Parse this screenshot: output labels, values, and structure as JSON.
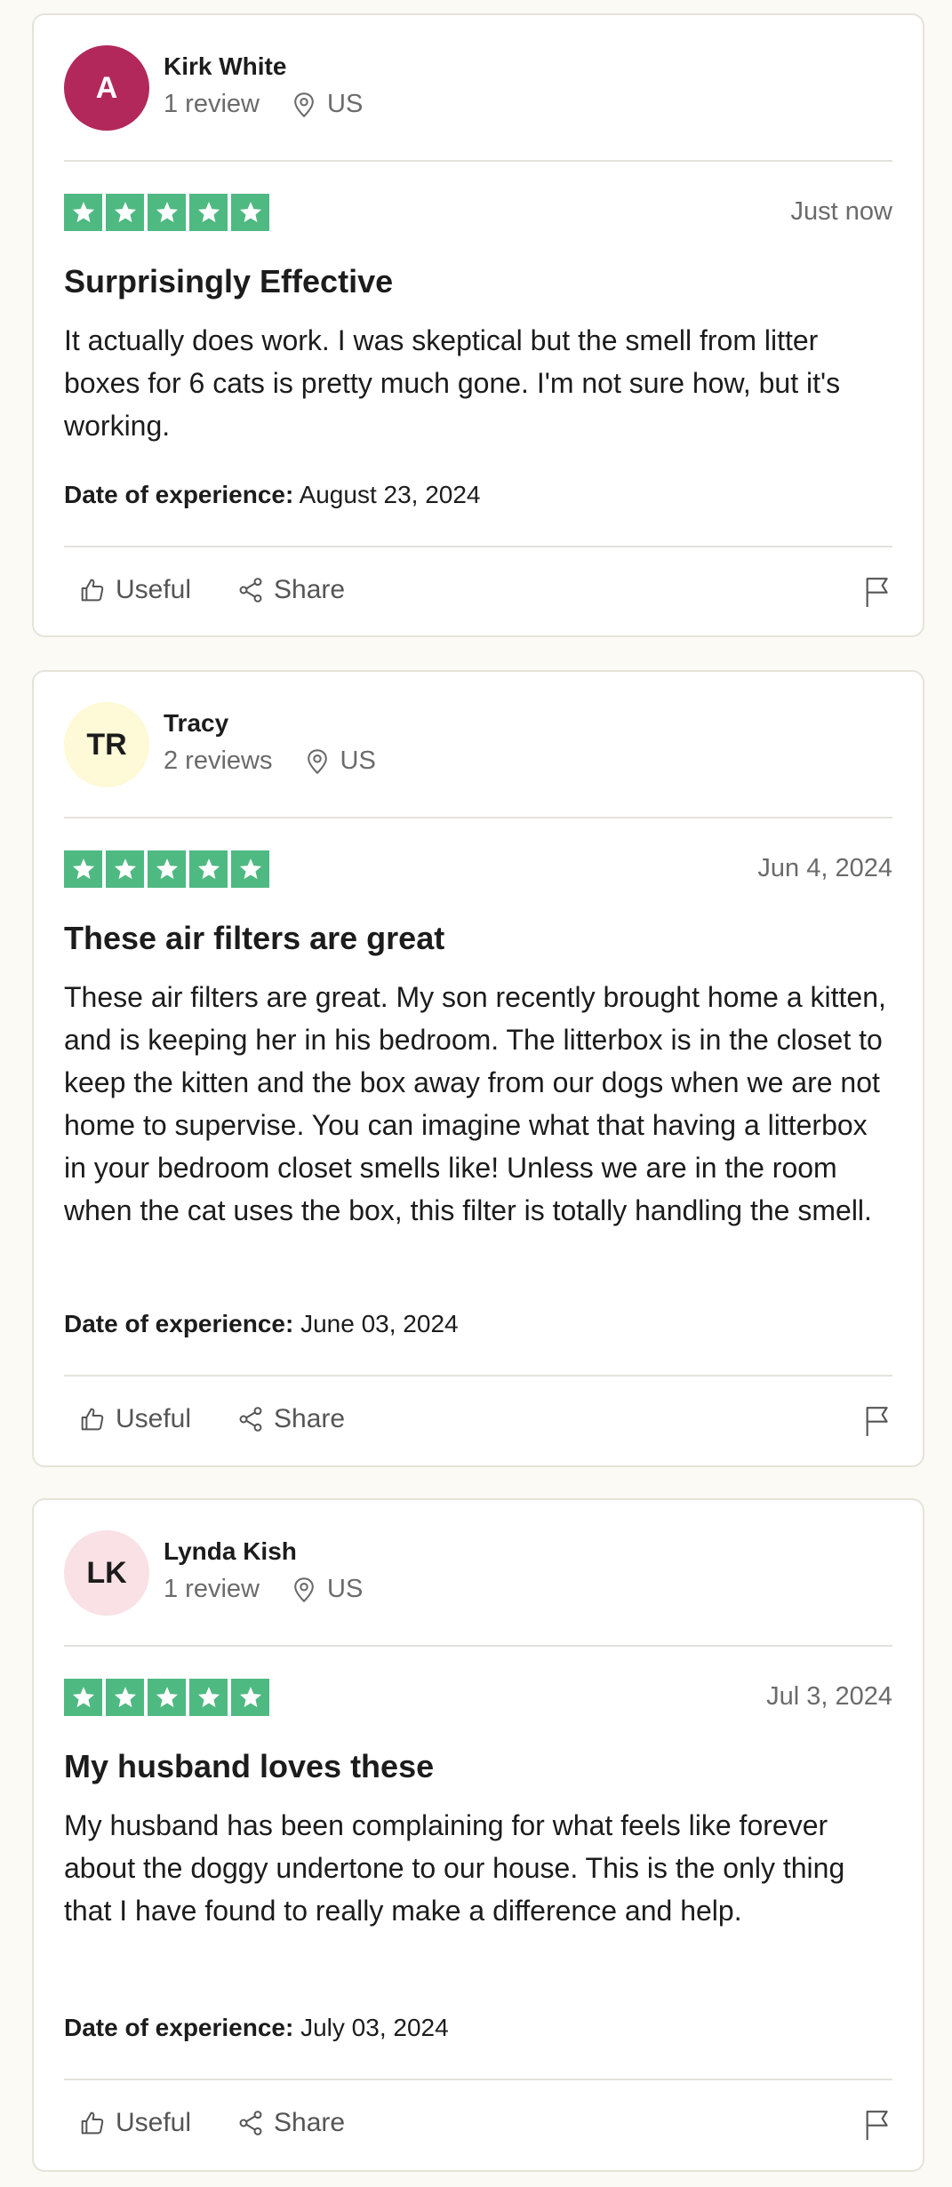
{
  "colors": {
    "page_background": "#fbfaf4",
    "star_green": "#4fb982",
    "text_primary": "#1c1c1c",
    "text_muted": "#6b6b6b"
  },
  "reviews": [
    {
      "avatar": {
        "initials": "A",
        "background": "#b3285b",
        "color": "#ffffff"
      },
      "name": "Kirk White",
      "review_count": "1 review",
      "location": "US",
      "rating": 5,
      "date": "Just now",
      "title": "Surprisingly Effective",
      "body": "It actually does work. I was skeptical but the smell from litter boxes for 6 cats is pretty much gone. I'm not sure how, but it's working.",
      "experience_label": "Date of experience:",
      "experience_date": " August 23, 2024",
      "useful_label": "Useful",
      "share_label": "Share"
    },
    {
      "avatar": {
        "initials": "TR",
        "background": "#fef9d6",
        "color": "#1c1c1c"
      },
      "name": "Tracy",
      "review_count": "2 reviews",
      "location": "US",
      "rating": 5,
      "date": "Jun 4, 2024",
      "title": "These air filters are great",
      "body": "These air filters are great. My son recently brought home a kitten, and is keeping her in his bedroom. The litterbox is in the closet to keep the kitten and the box away from our dogs when we are not home to supervise. You can imagine what that having a litterbox in your bedroom closet smells like! Unless we are in the room when the cat uses the box, this filter is totally handling the smell.",
      "experience_label": "Date of experience:",
      "experience_date": " June 03, 2024",
      "useful_label": "Useful",
      "share_label": "Share"
    },
    {
      "avatar": {
        "initials": "LK",
        "background": "#f9e1e6",
        "color": "#1c1c1c"
      },
      "name": "Lynda Kish",
      "review_count": "1 review",
      "location": "US",
      "rating": 5,
      "date": "Jul 3, 2024",
      "title": "My husband loves these",
      "body": "My husband has been complaining for what feels like forever about the doggy undertone to our house. This is the only thing that I have found to really make a difference and help.",
      "experience_label": "Date of experience:",
      "experience_date": " July 03, 2024",
      "useful_label": "Useful",
      "share_label": "Share"
    }
  ]
}
